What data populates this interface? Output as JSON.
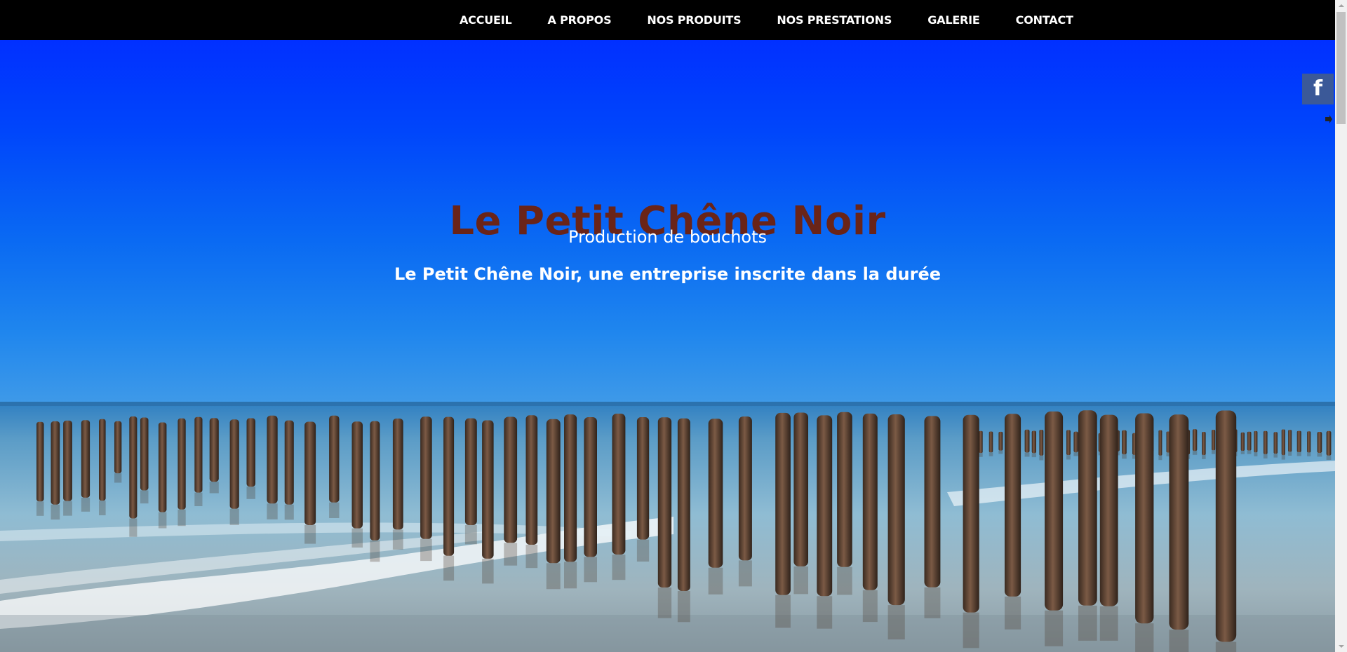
{
  "nav": {
    "items": [
      {
        "label": "ACCUEIL"
      },
      {
        "label": "A PROPOS"
      },
      {
        "label": "NOS PRODUITS"
      },
      {
        "label": "NOS PRESTATIONS"
      },
      {
        "label": "GALERIE"
      },
      {
        "label": "CONTACT"
      }
    ]
  },
  "hero": {
    "title": "Le Petit Chêne Noir",
    "subtitle": "Production de bouchots",
    "tagline": "Le Petit Chêne Noir, une entreprise inscrite dans la durée",
    "background_image": "mussel-poles-beach-photo"
  },
  "social": {
    "facebook_icon": "facebook-icon",
    "facebook_letter": "f",
    "collapse_icon": "arrow-right-icon"
  },
  "colors": {
    "nav_background": "#000000",
    "nav_text": "#ffffff",
    "title_color": "#6a2418",
    "subtitle_color": "#ffffff",
    "facebook_blue": "#3b5998",
    "sky_top": "#0032ff",
    "sky_bottom": "#2a8ef0"
  }
}
